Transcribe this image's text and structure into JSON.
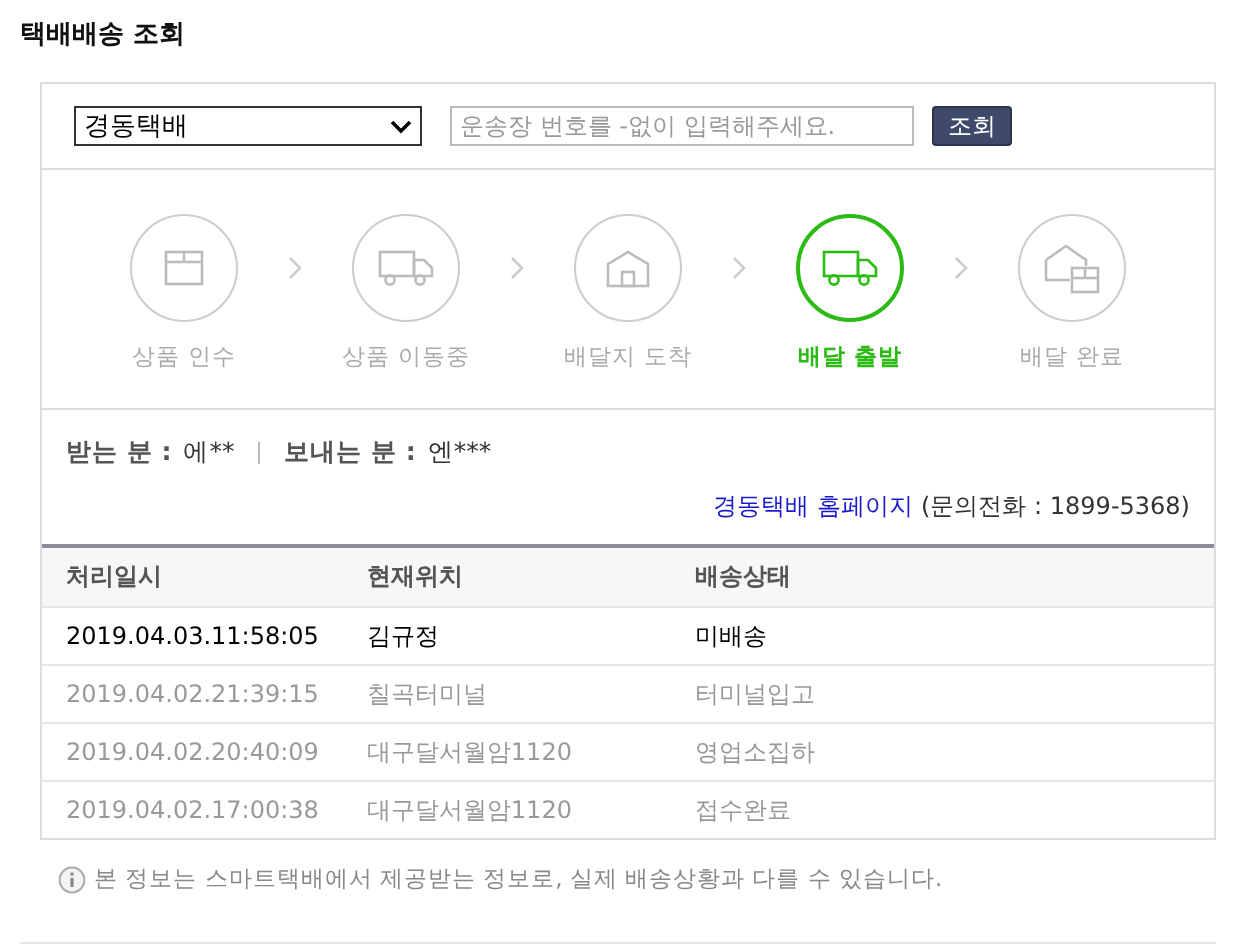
{
  "title": "택배배송 조회",
  "search": {
    "carrier": "경동택배",
    "placeholder": "운송장 번호를 -없이 입력해주세요.",
    "button": "조회"
  },
  "steps": [
    {
      "kind": "box",
      "label": "상품 인수",
      "current": false
    },
    {
      "kind": "truck",
      "label": "상품 이동중",
      "current": false
    },
    {
      "kind": "house",
      "label": "배달지 도착",
      "current": false
    },
    {
      "kind": "truck",
      "label": "배달 출발",
      "current": true
    },
    {
      "kind": "house-box",
      "label": "배달 완료",
      "current": false
    }
  ],
  "recipient": {
    "label": "받는 분 :",
    "value": "에**"
  },
  "sender": {
    "label": "보내는 분 :",
    "value": "엔***"
  },
  "homepage_link": "경동택배 홈페이지",
  "contact": "(문의전화 : 1899-5368)",
  "table": {
    "columns": [
      "처리일시",
      "현재위치",
      "배송상태"
    ],
    "rows": [
      {
        "cells": [
          "2019.04.03.11:58:05",
          "김규정",
          "미배송"
        ],
        "current": true
      },
      {
        "cells": [
          "2019.04.02.21:39:15",
          "칠곡터미널",
          "터미널입고"
        ],
        "current": false
      },
      {
        "cells": [
          "2019.04.02.20:40:09",
          "대구달서월암1120",
          "영업소집하"
        ],
        "current": false
      },
      {
        "cells": [
          "2019.04.02.17:00:38",
          "대구달서월암1120",
          "접수완료"
        ],
        "current": false
      }
    ]
  },
  "note": "본 정보는 스마트택배에서 제공받는 정보로, 실제 배송상황과 다를 수 있습니다."
}
